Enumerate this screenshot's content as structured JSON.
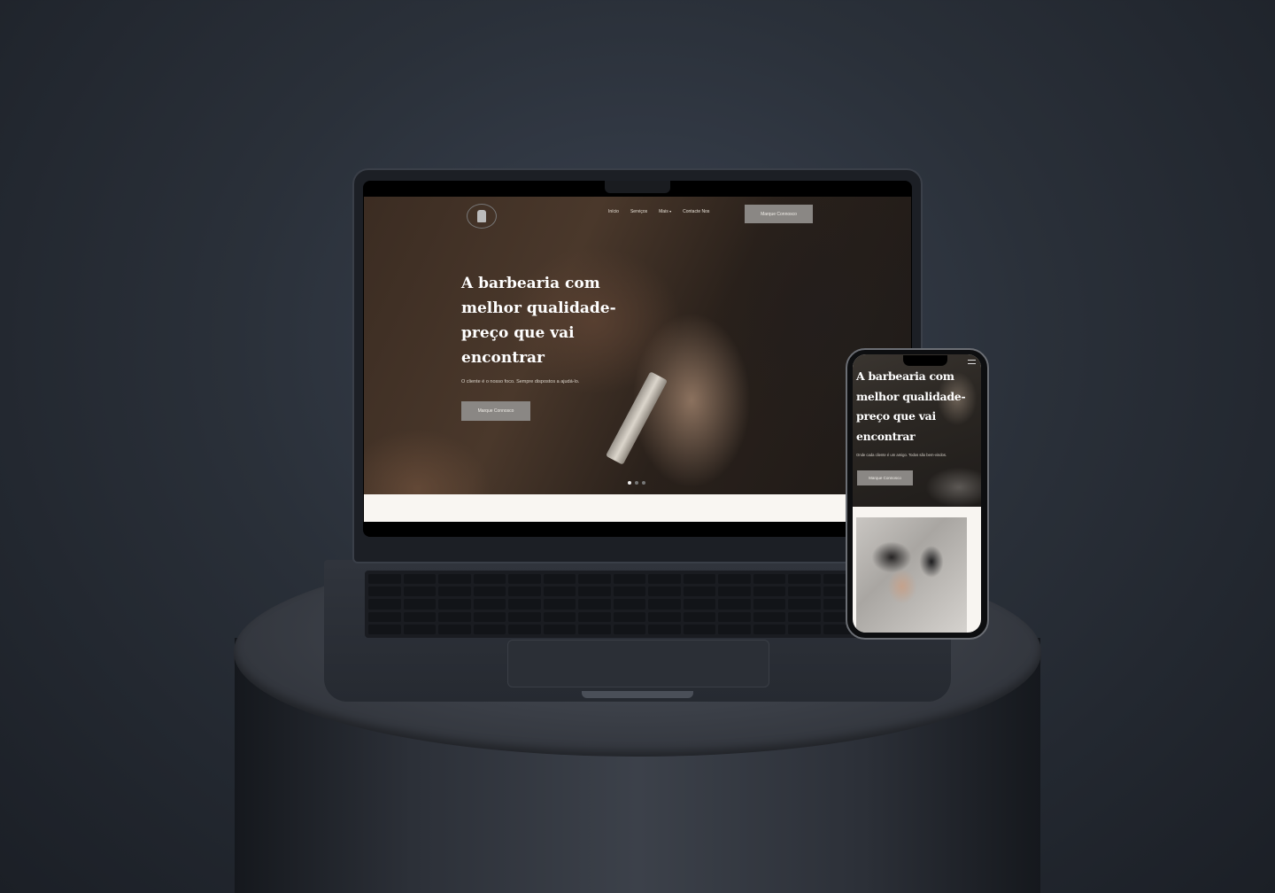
{
  "laptop_site": {
    "nav": {
      "items": [
        "Início",
        "Serviços",
        "Mais",
        "Contacte Nos"
      ],
      "cta": "Marque Connosco"
    },
    "hero": {
      "title": "A barbearia com melhor qualidade-preço que vai encontrar",
      "subtitle": "O cliente é o nosso foco. Sempre dispostos a ajudá-lo.",
      "cta": "Marque Connosco",
      "slide_count": 3,
      "active_slide": 1
    }
  },
  "phone_site": {
    "hero": {
      "title": "A barbearia com melhor qualidade-preço que vai encontrar",
      "subtitle": "Onde cada cliente é um amigo. Todos são bem-vindos.",
      "cta": "Marque Connosco"
    }
  },
  "colors": {
    "button_bg": "#8a8784",
    "strip_bg": "#f9f6f2",
    "backdrop": "#2a3039"
  },
  "icons": [
    "barbershop-logo-icon",
    "menu-icon",
    "chevron-down-icon"
  ]
}
